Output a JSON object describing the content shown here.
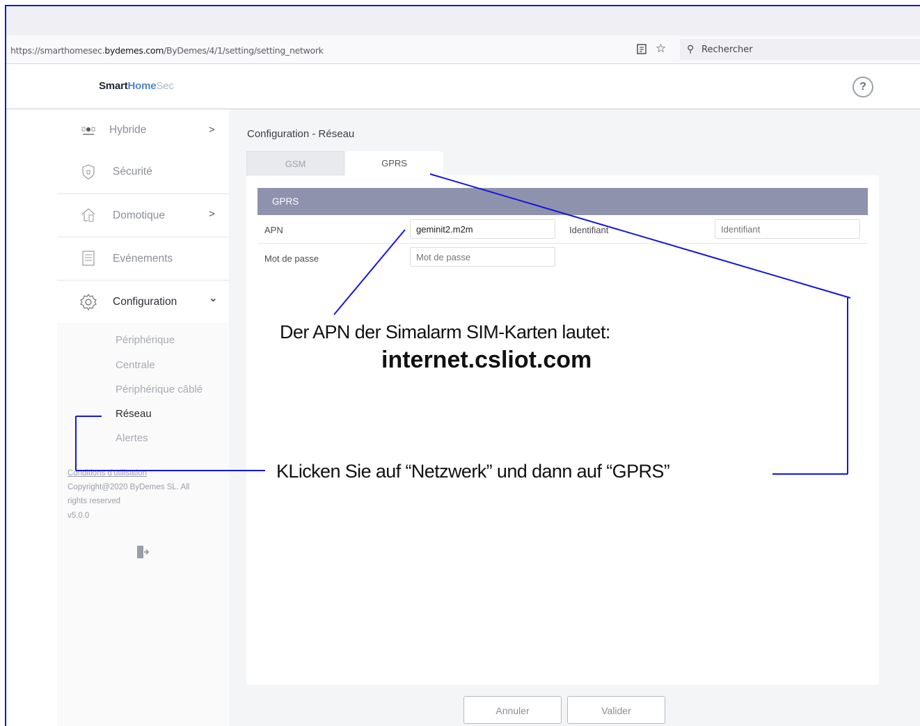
{
  "browser": {
    "url_prefix": "https://smarthomesec.",
    "url_domain": "bydemes.com",
    "url_path": "/ByDemes/4/1/setting/setting_network",
    "search_placeholder": "Rechercher"
  },
  "app": {
    "logo_smart": "Smart",
    "logo_home": "Home",
    "logo_sec": "Sec",
    "help_label": "?"
  },
  "sidebar": {
    "items": [
      {
        "label": "Hybride",
        "icon": "hybrid-icon",
        "chevron": ">"
      },
      {
        "label": "Sécurité",
        "icon": "shield-icon"
      },
      {
        "label": "Domotique",
        "icon": "home-automation-icon",
        "chevron": ">"
      },
      {
        "label": "Evénements",
        "icon": "events-list-icon"
      },
      {
        "label": "Configuration",
        "icon": "gear-icon",
        "chevron": "⌄"
      }
    ],
    "subitems": [
      "Périphérique",
      "Centrale",
      "Périphérique câblé",
      "Réseau",
      "Alertes"
    ],
    "active_subitem": "Réseau",
    "footer": {
      "terms": "Conditions d'utilisation",
      "copyright_1": "Copyright@2020 ByDemes SL. All",
      "copyright_2": "rights reserved",
      "version": "v5.0.0"
    }
  },
  "main": {
    "title": "Configuration - Réseau",
    "tabs": [
      {
        "label": "GSM"
      },
      {
        "label": "GPRS"
      }
    ],
    "active_tab": "GPRS",
    "section_title": "GPRS",
    "fields": {
      "apn_label": "APN",
      "apn_value": "geminit2.m2m",
      "identifiant_label": "Identifiant",
      "identifiant_placeholder": "Identifiant",
      "password_label": "Mot de passe",
      "password_placeholder": "Mot de passe"
    },
    "buttons": {
      "cancel": "Annuler",
      "validate": "Valider"
    }
  },
  "annotations": {
    "apn_note": "Der APN der Simalarm SIM-Karten lautet:",
    "apn_value": "internet.csliot.com",
    "click_note": "KLicken Sie auf “Netzwerk” und dann auf “GPRS”",
    "line_color": "#1414e0"
  }
}
